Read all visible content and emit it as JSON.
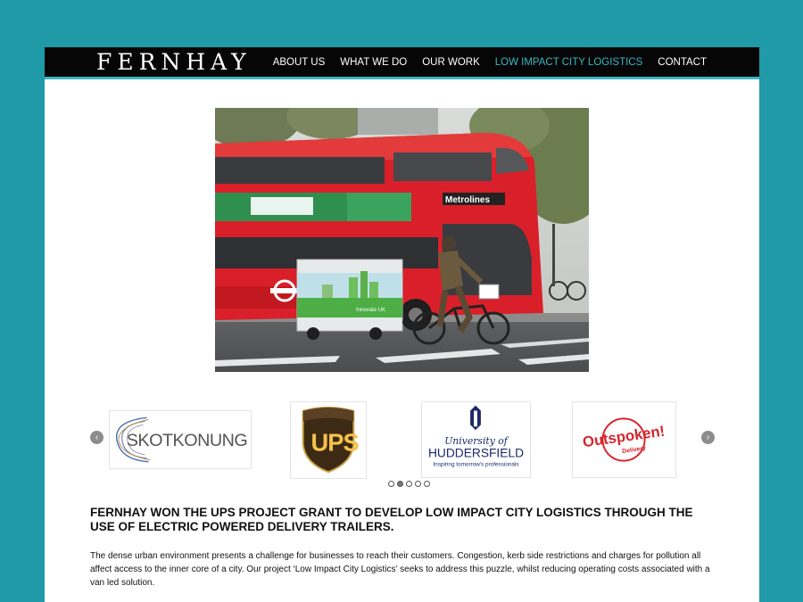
{
  "header": {
    "logo_text": "FERNHAY",
    "nav": [
      {
        "label": "ABOUT US"
      },
      {
        "label": "WHAT WE DO"
      },
      {
        "label": "OUR WORK"
      },
      {
        "label": "LOW IMPACT CITY LOGISTICS"
      },
      {
        "label": "CONTACT"
      }
    ],
    "active_nav_index": 3
  },
  "hero": {
    "bus_ad_banner": "Metrolines",
    "trailer_text": "Innovate UK"
  },
  "partners": {
    "logos": [
      {
        "name": "SKOTKONUNG"
      },
      {
        "name": "UPS"
      },
      {
        "line1": "University of",
        "line2": "HUDDERSFIELD",
        "tagline": "Inspiring tomorrow's professionals"
      },
      {
        "line1": "Outspoken!",
        "line2": "Delivery"
      }
    ],
    "dots_count": 5,
    "active_dot": 1
  },
  "content": {
    "headline": "FERNHAY WON THE UPS PROJECT GRANT TO DEVELOP LOW IMPACT CITY LOGISTICS THROUGH THE USE OF ELECTRIC POWERED DELIVERY TRAILERS.",
    "body": "The dense urban environment presents a challenge for businesses to reach their customers. Congestion, kerb side restrictions and charges for pollution all affect access to the inner core of a city. Our project ‘Low Impact City Logistics’ seeks to address this puzzle, whilst reducing operating costs associated with a van led solution."
  },
  "colors": {
    "page_bg": "#1f9aa6",
    "accent": "#38b6c4",
    "navbar_bg": "#060606"
  }
}
